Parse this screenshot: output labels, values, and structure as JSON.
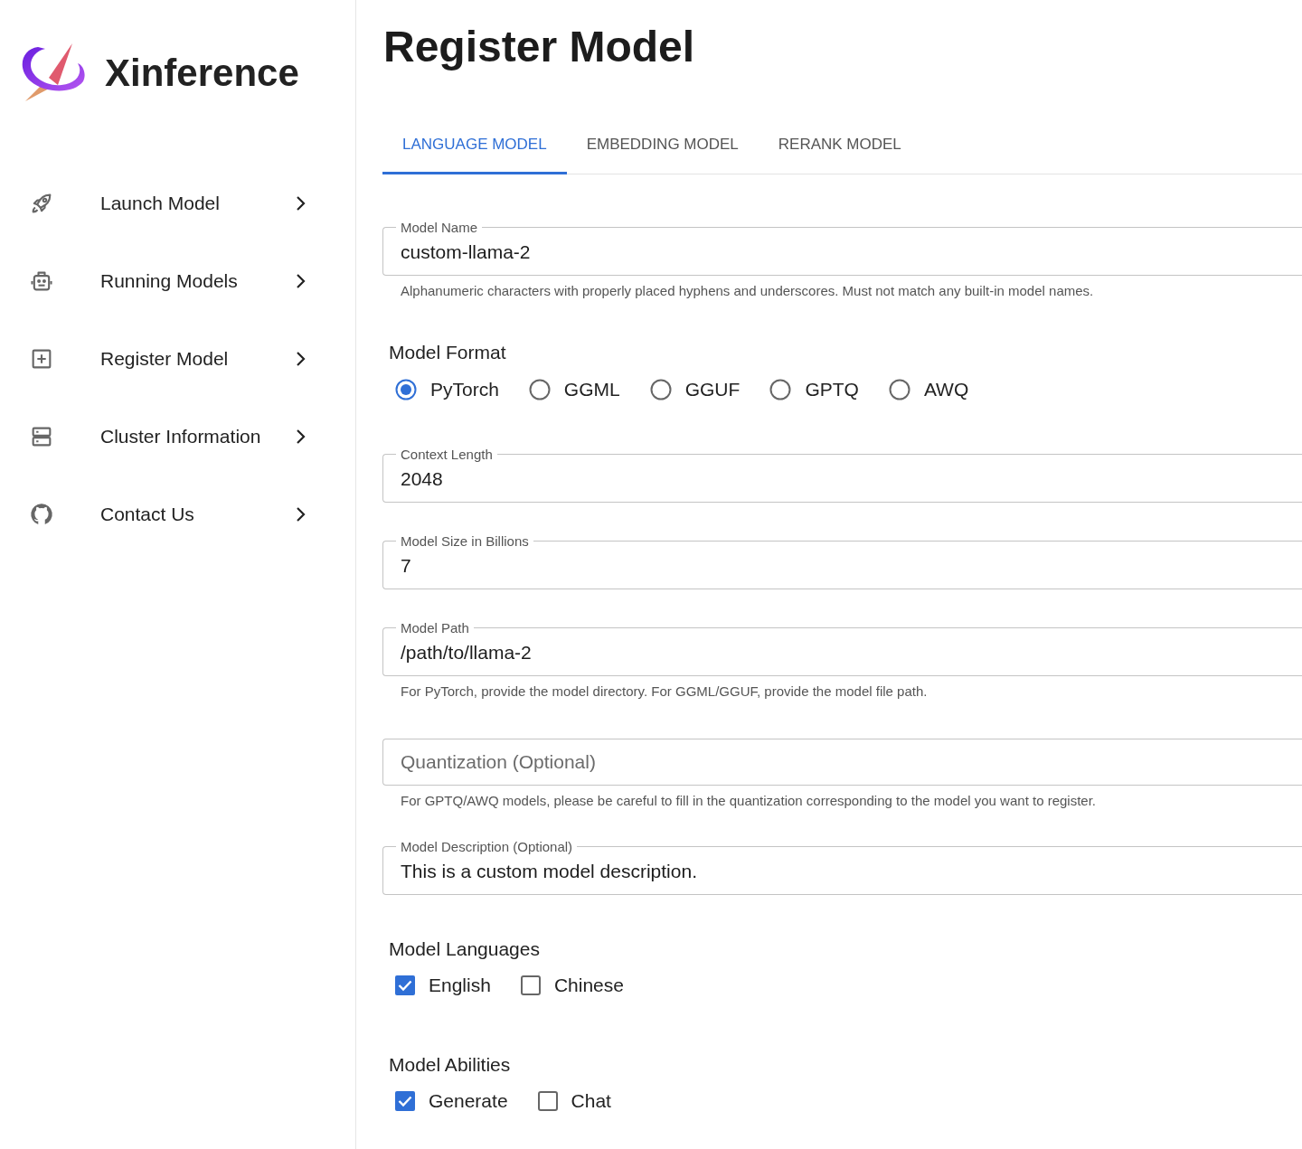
{
  "brand": {
    "name": "Xinference"
  },
  "sidebar": {
    "items": [
      {
        "label": "Launch Model"
      },
      {
        "label": "Running Models"
      },
      {
        "label": "Register Model"
      },
      {
        "label": "Cluster Information"
      },
      {
        "label": "Contact Us"
      }
    ]
  },
  "page_title": "Register Model",
  "tabs": [
    {
      "label": "LANGUAGE MODEL",
      "selected": true
    },
    {
      "label": "EMBEDDING MODEL",
      "selected": false
    },
    {
      "label": "RERANK MODEL",
      "selected": false
    }
  ],
  "form": [
    {
      "kind": "text",
      "label": "Model Name",
      "value": "custom-llama-2",
      "helper": "Alphanumeric characters with properly placed hyphens and underscores. Must not match any built-in model names."
    },
    {
      "kind": "radio",
      "label": "Model Format",
      "options": [
        {
          "label": "PyTorch",
          "selected": true
        },
        {
          "label": "GGML",
          "selected": false
        },
        {
          "label": "GGUF",
          "selected": false
        },
        {
          "label": "GPTQ",
          "selected": false
        },
        {
          "label": "AWQ",
          "selected": false
        }
      ]
    },
    {
      "kind": "text",
      "label": "Context Length",
      "value": "2048"
    },
    {
      "kind": "text",
      "label": "Model Size in Billions",
      "value": "7"
    },
    {
      "kind": "text",
      "label": "Model Path",
      "value": "/path/to/llama-2",
      "helper": "For PyTorch, provide the model directory. For GGML/GGUF, provide the model file path."
    },
    {
      "kind": "text",
      "placeholder": "Quantization (Optional)",
      "helper": "For GPTQ/AWQ models, please be careful to fill in the quantization corresponding to the model you want to register."
    },
    {
      "kind": "text",
      "label": "Model Description (Optional)",
      "value": "This is a custom model description."
    },
    {
      "kind": "check",
      "label": "Model Languages",
      "options": [
        {
          "label": "English",
          "checked": true
        },
        {
          "label": "Chinese",
          "checked": false
        }
      ]
    },
    {
      "kind": "check",
      "label": "Model Abilities",
      "options": [
        {
          "label": "Generate",
          "checked": true
        },
        {
          "label": "Chat",
          "checked": false
        }
      ]
    }
  ]
}
